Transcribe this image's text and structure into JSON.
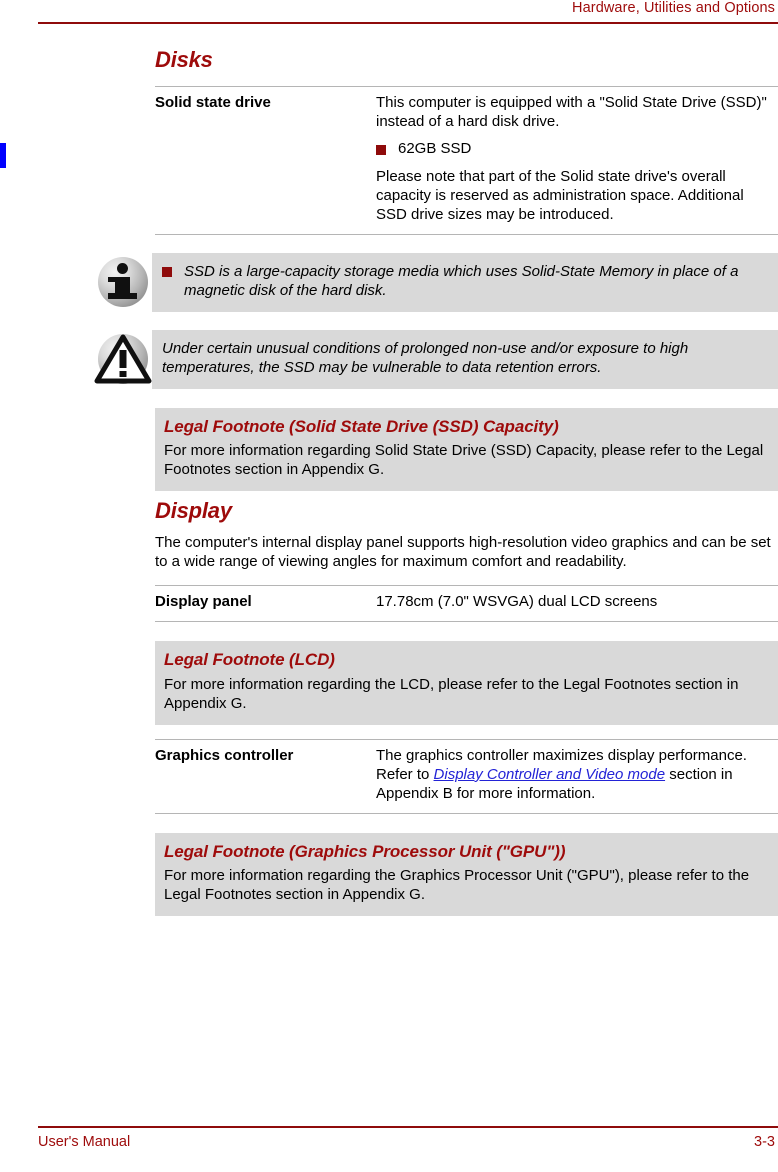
{
  "header": {
    "title": "Hardware, Utilities and Options"
  },
  "footer": {
    "left_label": "User's Manual",
    "page_number": "3-3"
  },
  "colors": {
    "accent_red": "#9e0b0b",
    "rule_red": "#8f0b0b",
    "panel_gray": "#d9d9d9",
    "link_blue": "#2323d6",
    "change_bar_blue": "#0000ff"
  },
  "sections": {
    "disks": {
      "heading": "Disks",
      "table": [
        {
          "term": "Solid state drive",
          "paragraphs": [
            "This computer is equipped with a \"Solid State Drive (SSD)\" instead of a hard disk drive."
          ],
          "bullets": [
            "62GB SSD"
          ],
          "paragraphs_after": [
            "Please note that part of the Solid state drive's overall capacity is reserved as administration space. Additional SSD drive sizes may be introduced."
          ]
        }
      ],
      "note": {
        "icon": "info-icon",
        "bullet": true,
        "text": "SSD is a large-capacity storage media which uses Solid-State Memory in place of a magnetic disk of the hard disk."
      },
      "caution": {
        "icon": "caution-icon",
        "bullet": false,
        "text": "Under certain unusual conditions of prolonged non-use and/or exposure to high temperatures, the SSD may be vulnerable to data retention errors."
      },
      "footnote": {
        "title": "Legal Footnote (Solid State Drive (SSD) Capacity)",
        "body": "For more information regarding Solid State Drive (SSD) Capacity, please refer to the Legal Footnotes section in Appendix G."
      }
    },
    "display": {
      "heading": "Display",
      "intro": "The computer's internal display panel supports high-resolution video graphics and can be set to a wide range of viewing angles for maximum comfort and readability.",
      "panel_row": {
        "term": "Display panel",
        "value": "17.78cm (7.0\" WSVGA) dual LCD screens"
      },
      "lcd_footnote": {
        "title": "Legal Footnote (LCD)",
        "body": "For more information regarding the LCD, please refer to the Legal Footnotes section in Appendix G."
      },
      "graphics_row": {
        "term": "Graphics controller",
        "text_before": "The graphics controller maximizes display performance. Refer to ",
        "link": "Display Controller and Video mode",
        "text_after": " section in Appendix B for more information."
      },
      "gpu_footnote": {
        "title": "Legal Footnote (Graphics Processor Unit (\"GPU\"))",
        "body": "For more information regarding the Graphics Processor Unit (\"GPU\"), please refer to the Legal Footnotes section in Appendix G."
      }
    }
  }
}
